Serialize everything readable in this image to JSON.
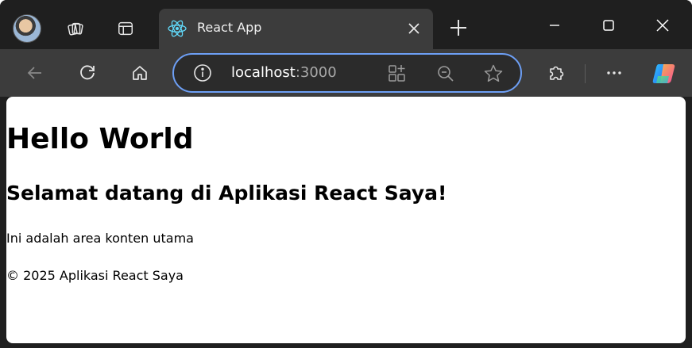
{
  "browser": {
    "tab": {
      "title": "React App",
      "favicon": "react-logo-icon"
    },
    "address_bar": {
      "host": "localhost",
      "port": ":3000",
      "site_info_icon": "info-icon"
    },
    "icons": {
      "profile": "avatar",
      "workspaces": "workspaces-icon",
      "tab_actions": "tab-actions-icon",
      "close_tab": "close-icon",
      "new_tab": "plus-icon",
      "minimize": "minimize-icon",
      "maximize": "maximize-icon",
      "close_window": "close-icon",
      "back": "back-arrow-icon",
      "refresh": "refresh-icon",
      "home": "home-icon",
      "add_app": "app-add-icon",
      "zoom_out": "zoom-out-icon",
      "favorite": "star-icon",
      "extensions": "puzzle-icon",
      "more": "more-icon",
      "copilot": "copilot-icon"
    },
    "colors": {
      "frame": "#1f1f1f",
      "toolbar": "#3c3c3c",
      "omnibox_focus": "#6d9ff5",
      "react_blue": "#61dafb"
    }
  },
  "page": {
    "heading": "Hello World",
    "subheading": "Selamat datang di Aplikasi React Saya!",
    "content": "Ini adalah area konten utama",
    "footer": "© 2025 Aplikasi React Saya"
  }
}
